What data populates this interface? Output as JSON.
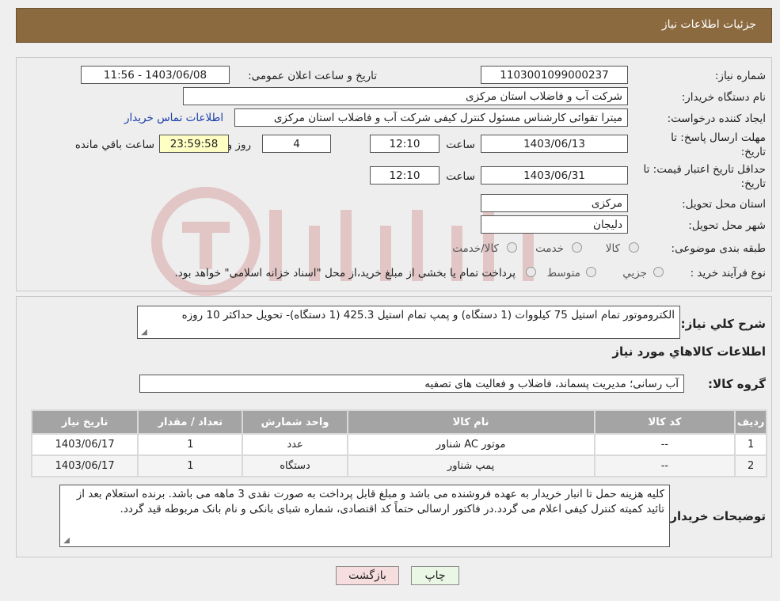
{
  "header": {
    "title": "جزئیات اطلاعات نیاز"
  },
  "form": {
    "need_number_label": "شماره نیاز:",
    "need_number": "1103001099000237",
    "announce_label": "تاریخ و ساعت اعلان عمومی:",
    "announce_value": "1403/06/08 - 11:56",
    "buyer_org_label": "نام دستگاه خریدار:",
    "buyer_org": "شرکت آب و فاضلاب استان مرکزی",
    "creator_label": "ایجاد کننده درخواست:",
    "creator": "میترا تقوائی کارشناس مسئول کنترل کیفی شرکت آب و فاضلاب استان مرکزی",
    "contact_link": "اطلاعات تماس خریدار",
    "deadline_label_1": "مهلت ارسال پاسخ: تا",
    "deadline_label_2": "تاریخ:",
    "deadline_date": "1403/06/13",
    "time_label": "ساعت",
    "deadline_time": "12:10",
    "days_value": "4",
    "days_label": "روز و",
    "remaining_time": "23:59:58",
    "remaining_label": "ساعت باقي مانده",
    "price_validity_label_1": "حداقل تاریخ اعتبار قیمت: تا",
    "price_validity_label_2": "تاریخ:",
    "price_validity_date": "1403/06/31",
    "price_validity_time": "12:10",
    "province_label": "استان محل تحویل:",
    "province": "مرکزی",
    "city_label": "شهر محل تحویل:",
    "city": "دلیجان",
    "category_label": "طبقه بندی موضوعی:",
    "category_options": [
      "کالا",
      "خدمت",
      "کالا/خدمت"
    ],
    "process_label": "نوع فرآیند خرید :",
    "process_options": [
      "جزیي",
      "متوسط"
    ],
    "process_note": "پرداخت تمام یا بخشی از مبلغ خرید،از محل \"اسناد خزانه اسلامی\" خواهد بود."
  },
  "description": {
    "label": "شرح کلي نیاز:",
    "text": "الکتروموتور تمام استیل 75 کیلووات (1 دستگاه) و پمپ تمام استیل 425.3 (1 دستگاه)- تحویل حداکثر 10 روزه"
  },
  "goods": {
    "section_title": "اطلاعات کالاهاي مورد نیاز",
    "group_label": "گروه کالا:",
    "group_value": "آب رسانی؛ مدیریت پسماند، فاضلاب و فعالیت های تصفیه",
    "columns": [
      "ردیف",
      "کد کالا",
      "نام کالا",
      "واحد شمارش",
      "تعداد / مقدار",
      "تاریخ نیاز"
    ],
    "rows": [
      [
        "1",
        "--",
        "موتور AC شناور",
        "عدد",
        "1",
        "1403/06/17"
      ],
      [
        "2",
        "--",
        "پمپ شناور",
        "دستگاه",
        "1",
        "1403/06/17"
      ]
    ]
  },
  "buyer_notes": {
    "label": "توضیحات خریدار:",
    "text": "کلیه هزینه حمل تا انبار خریدار به عهده فروشنده می باشد و مبلغ قابل پرداخت به صورت نقدی 3 ماهه می باشد. برنده استعلام بعد از تائید کمیته کنترل کیفی اعلام می گردد.در فاکتور ارسالی حتماً کد اقتصادی، شماره شبای بانکی و نام بانک مربوطه قید گردد."
  },
  "buttons": {
    "print": "چاپ",
    "back": "بازگشت"
  },
  "colors": {
    "header": "#8b6a40",
    "link": "#1a3ea8",
    "remaining_bg": "#ffffc4",
    "print_bg": "#eaf7e4",
    "back_bg": "#f6dede"
  }
}
